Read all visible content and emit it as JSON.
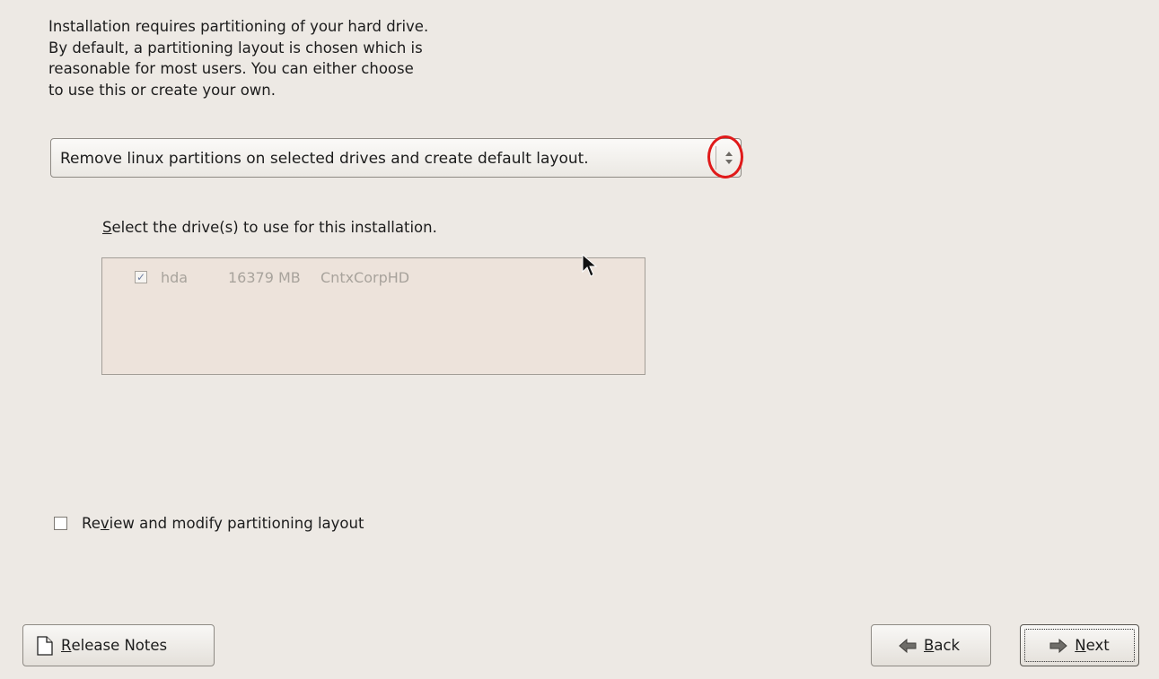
{
  "intro_text": "Installation requires partitioning of your hard drive.\nBy default, a partitioning layout is chosen which is\nreasonable for most users.  You can either choose\nto use this or create your own.",
  "partition_combo": {
    "selected_value": "Remove linux partitions on selected drives and create default layout."
  },
  "drives_section": {
    "label_mnemonic": "S",
    "label_rest": "elect the drive(s) to use for this installation.",
    "drives": [
      {
        "name": "hda",
        "size": "16379 MB",
        "model": "CntxCorpHD",
        "checked": true
      }
    ]
  },
  "review_option": {
    "label_before": "Re",
    "label_mnemonic": "v",
    "label_after": "iew and modify partitioning layout",
    "checked": false
  },
  "buttons": {
    "release_notes": {
      "mnemonic": "R",
      "rest": "elease Notes",
      "icon": "document-icon"
    },
    "back": {
      "mnemonic": "B",
      "rest": "ack",
      "icon": "arrow-left-icon"
    },
    "next": {
      "mnemonic": "N",
      "rest": "ext",
      "icon": "arrow-right-icon"
    }
  },
  "annotation_color": "#e01a1a"
}
